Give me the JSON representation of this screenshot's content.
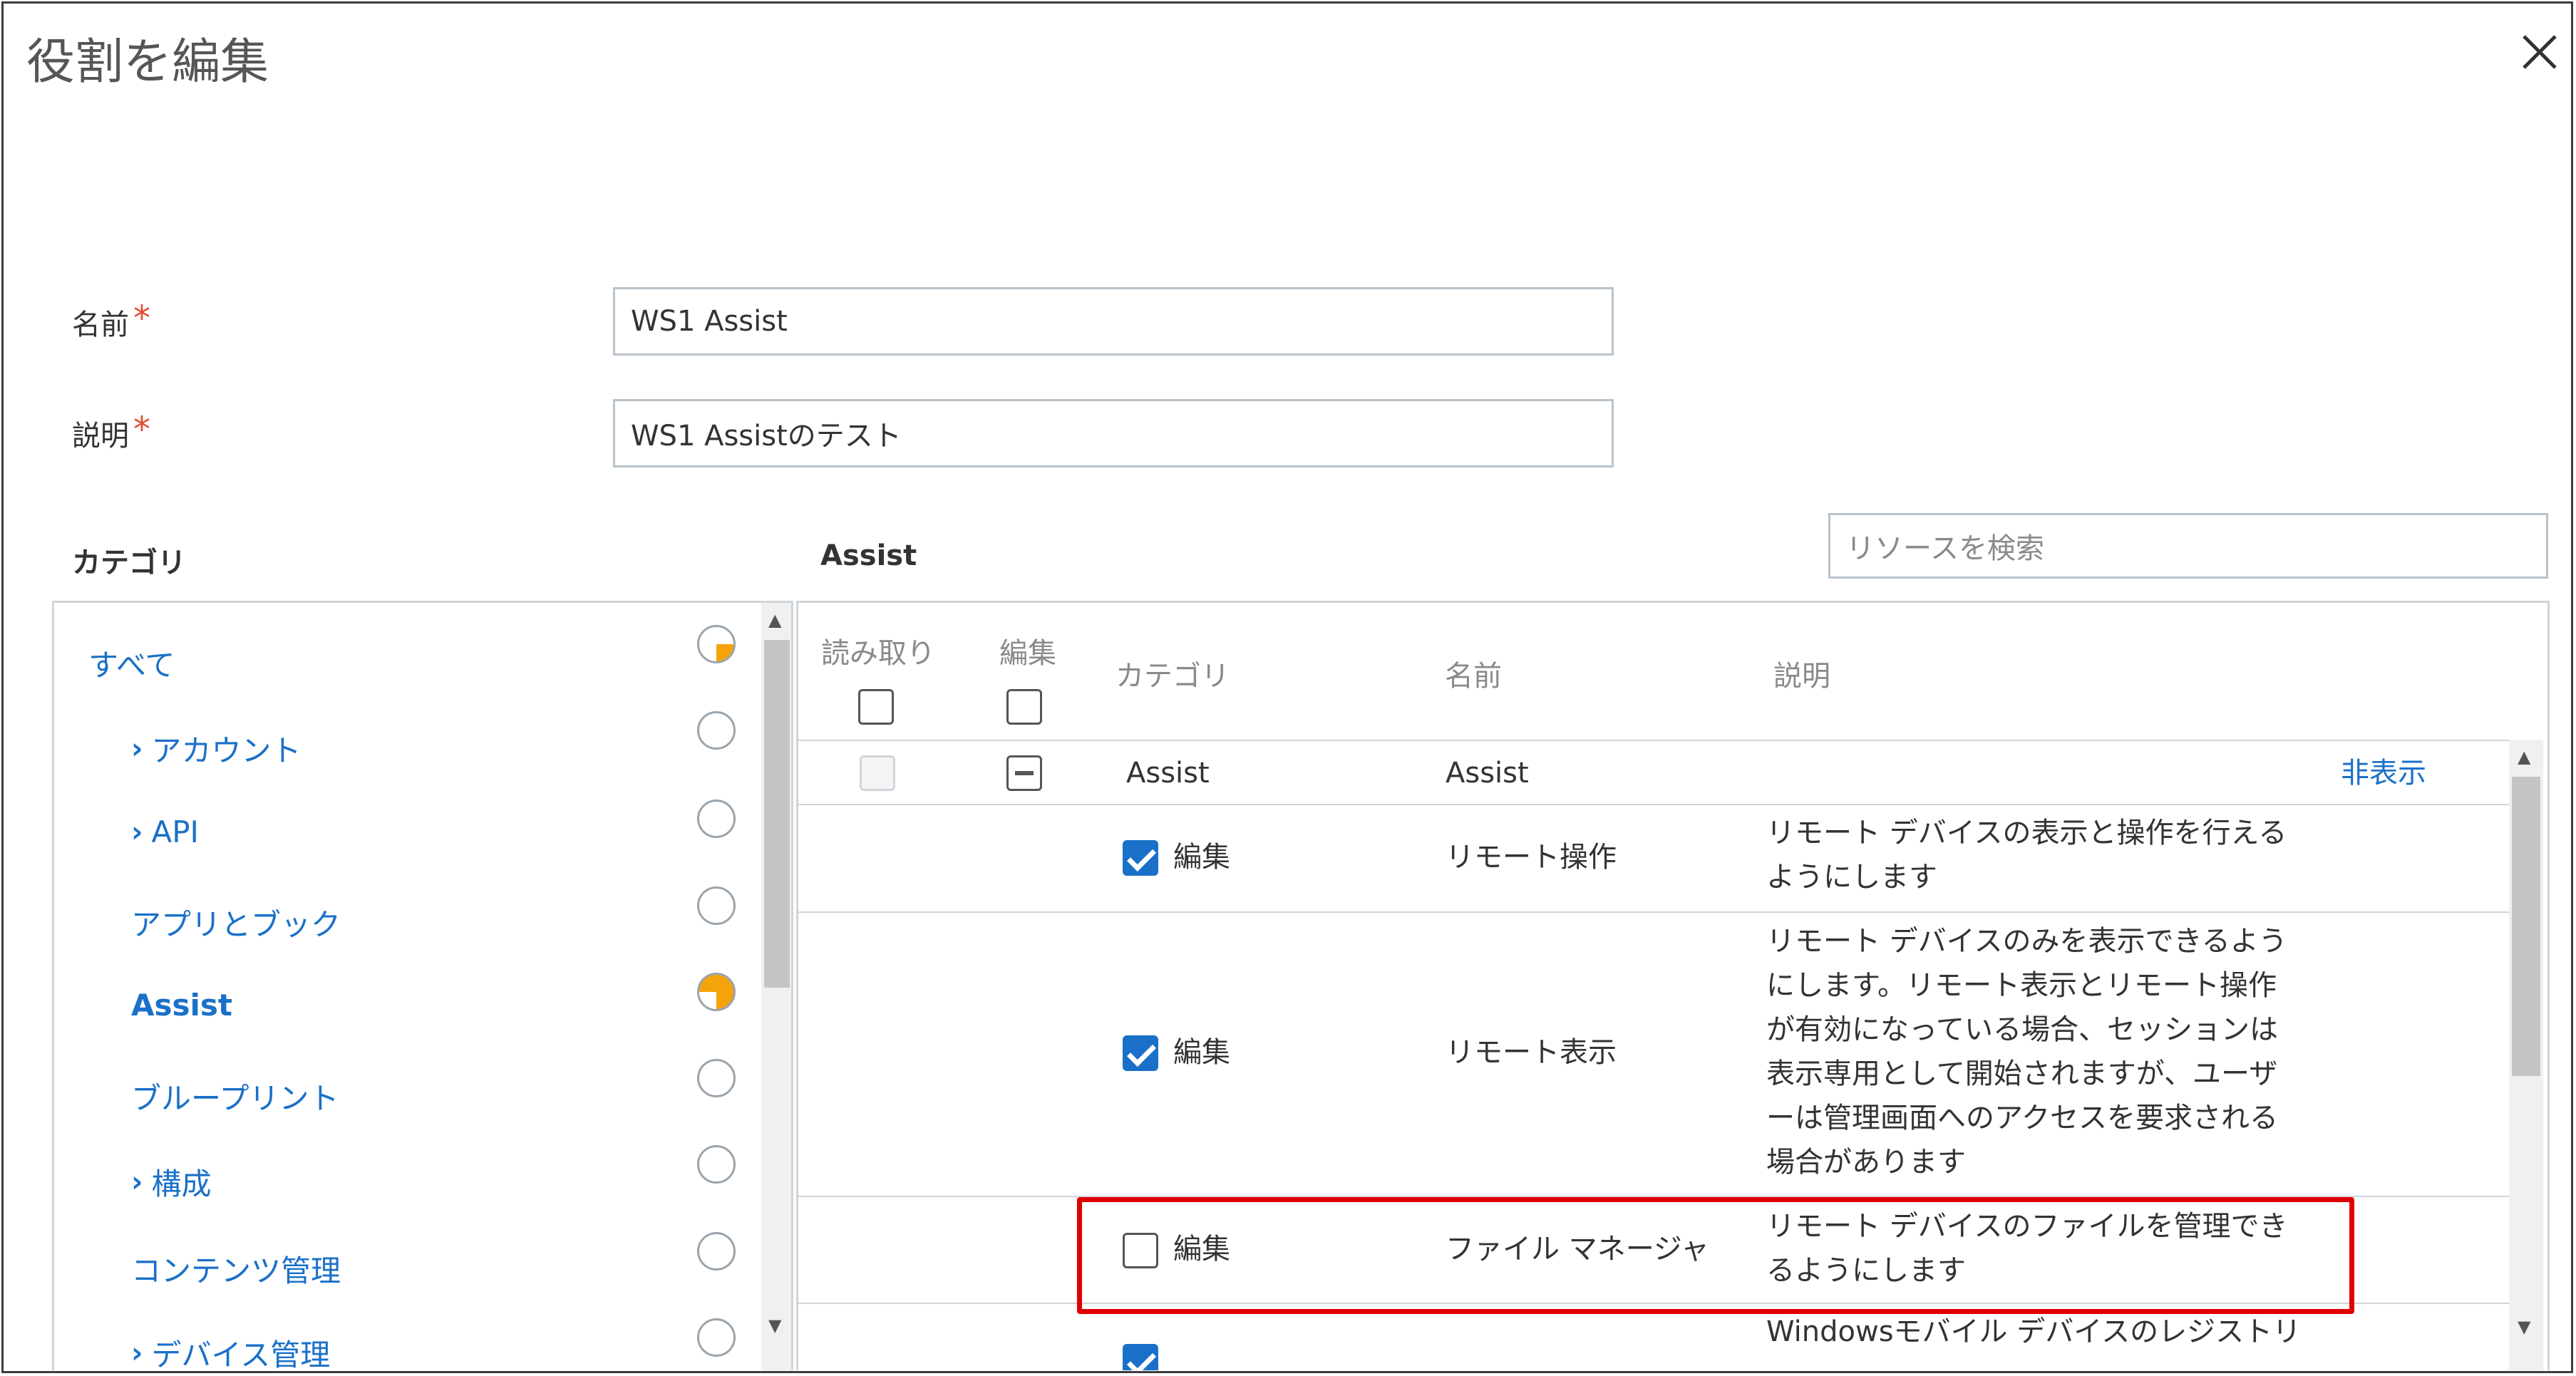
{
  "dialog": {
    "title": "役割を編集"
  },
  "form": {
    "name_label": "名前",
    "name_value": "WS1 Assist",
    "desc_label": "説明",
    "desc_value": "WS1 Assistのテスト",
    "required_mark": "*"
  },
  "category_panel": {
    "heading": "カテゴリ",
    "items": [
      {
        "label": "すべて",
        "chevron": ""
      },
      {
        "label": "アカウント",
        "chevron": "›"
      },
      {
        "label": "API",
        "chevron": "›"
      },
      {
        "label": "アプリとブック",
        "chevron": ""
      },
      {
        "label": "Assist",
        "chevron": ""
      },
      {
        "label": "ブループリント",
        "chevron": ""
      },
      {
        "label": "構成",
        "chevron": "›"
      },
      {
        "label": "コンテンツ管理",
        "chevron": ""
      },
      {
        "label": "デバイス管理",
        "chevron": "›"
      }
    ],
    "selected_index": 4
  },
  "resource_panel": {
    "heading": "Assist",
    "search_placeholder": "リソースを検索",
    "columns": {
      "read": "読み取り",
      "edit": "編集",
      "category": "カテゴリ",
      "name": "名前",
      "description": "説明"
    },
    "group_row": {
      "category": "Assist",
      "name": "Assist",
      "action": "非表示"
    },
    "rows": [
      {
        "checked": true,
        "perm": "編集",
        "name": "リモート操作",
        "desc_lines": [
          "リモート デバイスの表示と操作を行える",
          "ようにします"
        ]
      },
      {
        "checked": true,
        "perm": "編集",
        "name": "リモート表示",
        "desc_lines": [
          "リモート デバイスのみを表示できるよう",
          "にします。リモート表示とリモート操作",
          "が有効になっている場合、セッションは",
          "表示専用として開始されますが、ユーザ",
          "ーは管理画面へのアクセスを要求される",
          "場合があります"
        ]
      },
      {
        "checked": false,
        "perm": "編集",
        "name": "ファイル マネージャ",
        "desc_lines": [
          "リモート デバイスのファイルを管理でき",
          "るようにします"
        ]
      },
      {
        "checked": true,
        "perm": "",
        "name": "",
        "desc_lines": [
          "Windowsモバイル デバイスのレジストリ"
        ]
      }
    ]
  }
}
